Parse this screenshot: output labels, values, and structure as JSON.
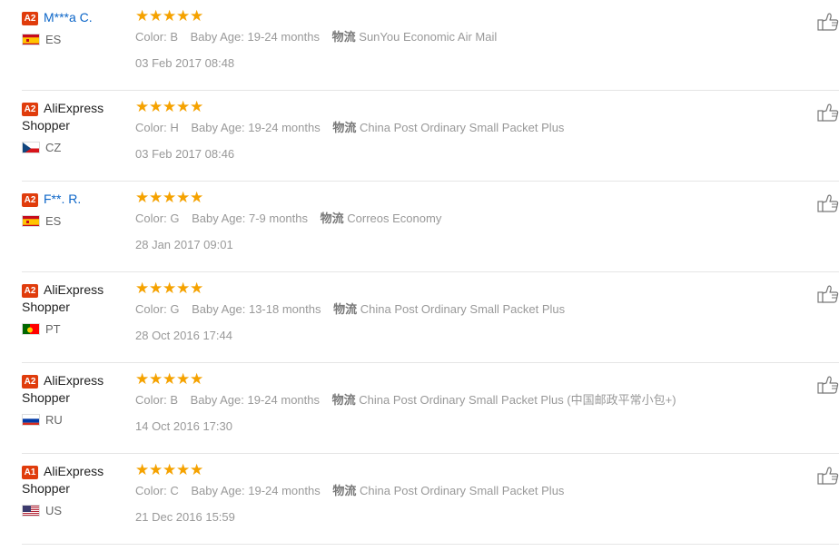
{
  "reviews": [
    {
      "level": "A2",
      "name_line1": "M***a C.",
      "name_line2": "",
      "name_style": "link",
      "flag": "es",
      "country": "ES",
      "stars": 5,
      "color_label": "Color:",
      "color_value": "B",
      "age_label": "Baby Age:",
      "age_value": "19-24 months",
      "ship_label": "物流",
      "ship_value": "SunYou Economic Air Mail",
      "date": "03 Feb 2017 08:48"
    },
    {
      "level": "A2",
      "name_line1": "AliExpress",
      "name_line2": "Shopper",
      "name_style": "plain",
      "flag": "cz",
      "country": "CZ",
      "stars": 5,
      "color_label": "Color:",
      "color_value": "H",
      "age_label": "Baby Age:",
      "age_value": "19-24 months",
      "ship_label": "物流",
      "ship_value": "China Post Ordinary Small Packet Plus",
      "date": "03 Feb 2017 08:46"
    },
    {
      "level": "A2",
      "name_line1": "F**. R.",
      "name_line2": "",
      "name_style": "link",
      "flag": "es",
      "country": "ES",
      "stars": 5,
      "color_label": "Color:",
      "color_value": "G",
      "age_label": "Baby Age:",
      "age_value": "7-9 months",
      "ship_label": "物流",
      "ship_value": "Correos Economy",
      "date": "28 Jan 2017 09:01"
    },
    {
      "level": "A2",
      "name_line1": "AliExpress",
      "name_line2": "Shopper",
      "name_style": "plain",
      "flag": "pt",
      "country": "PT",
      "stars": 5,
      "color_label": "Color:",
      "color_value": "G",
      "age_label": "Baby Age:",
      "age_value": "13-18 months",
      "ship_label": "物流",
      "ship_value": "China Post Ordinary Small Packet Plus",
      "date": "28 Oct 2016 17:44"
    },
    {
      "level": "A2",
      "name_line1": "AliExpress",
      "name_line2": "Shopper",
      "name_style": "plain",
      "flag": "ru",
      "country": "RU",
      "stars": 5,
      "color_label": "Color:",
      "color_value": "B",
      "age_label": "Baby Age:",
      "age_value": "19-24 months",
      "ship_label": "物流",
      "ship_value": "China Post Ordinary Small Packet Plus (中国邮政平常小包+)",
      "date": "14 Oct 2016 17:30"
    },
    {
      "level": "A1",
      "name_line1": "AliExpress",
      "name_line2": "Shopper",
      "name_style": "plain",
      "flag": "us",
      "country": "US",
      "stars": 5,
      "color_label": "Color:",
      "color_value": "C",
      "age_label": "Baby Age:",
      "age_value": "19-24 months",
      "ship_label": "物流",
      "ship_value": "China Post Ordinary Small Packet Plus",
      "date": "21 Dec 2016 15:59"
    }
  ],
  "colors": {
    "badge": "#e03c0c",
    "star": "#f5a200",
    "link": "#0b65c8",
    "muted": "#999999"
  },
  "icons": {
    "star": "star-icon",
    "like": "thumbs-up-icon"
  }
}
